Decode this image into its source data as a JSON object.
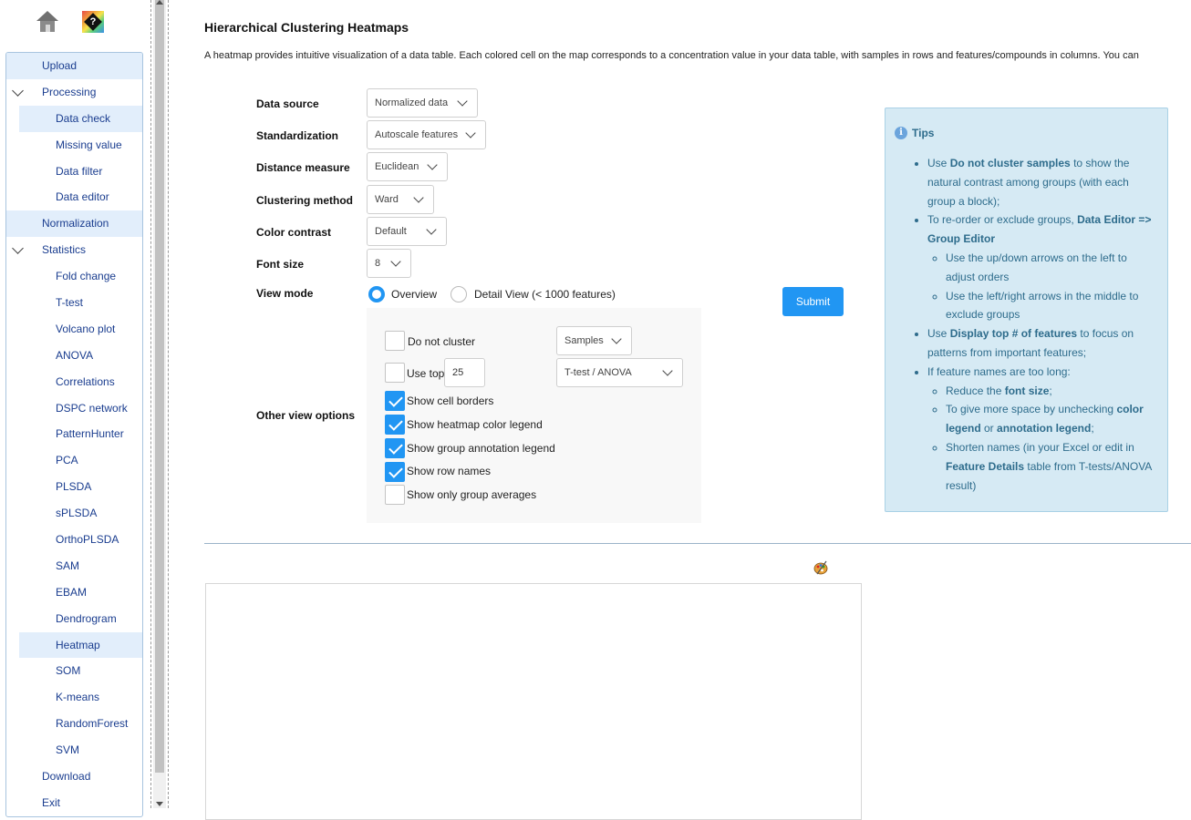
{
  "sidebar": {
    "menu": [
      {
        "label": "Upload",
        "level": 0,
        "highlight": true
      },
      {
        "label": "Processing",
        "level": 0,
        "expanded": true
      },
      {
        "label": "Data check",
        "level": 1,
        "highlight": true
      },
      {
        "label": "Missing value",
        "level": 1
      },
      {
        "label": "Data filter",
        "level": 1
      },
      {
        "label": "Data editor",
        "level": 1
      },
      {
        "label": "Normalization",
        "level": 0,
        "highlight": true
      },
      {
        "label": "Statistics",
        "level": 0,
        "expanded": true
      },
      {
        "label": "Fold change",
        "level": 1
      },
      {
        "label": "T-test",
        "level": 1
      },
      {
        "label": "Volcano plot",
        "level": 1
      },
      {
        "label": "ANOVA",
        "level": 1
      },
      {
        "label": "Correlations",
        "level": 1
      },
      {
        "label": "DSPC network",
        "level": 1
      },
      {
        "label": "PatternHunter",
        "level": 1
      },
      {
        "label": "PCA",
        "level": 1
      },
      {
        "label": "PLSDA",
        "level": 1
      },
      {
        "label": "sPLSDA",
        "level": 1
      },
      {
        "label": "OrthoPLSDA",
        "level": 1
      },
      {
        "label": "SAM",
        "level": 1
      },
      {
        "label": "EBAM",
        "level": 1
      },
      {
        "label": "Dendrogram",
        "level": 1
      },
      {
        "label": "Heatmap",
        "level": 1,
        "highlight": true
      },
      {
        "label": "SOM",
        "level": 1
      },
      {
        "label": "K-means",
        "level": 1
      },
      {
        "label": "RandomForest",
        "level": 1
      },
      {
        "label": "SVM",
        "level": 1
      },
      {
        "label": "Download",
        "level": 0
      },
      {
        "label": "Exit",
        "level": 0
      }
    ]
  },
  "main": {
    "title": "Hierarchical Clustering Heatmaps",
    "description": "A heatmap provides intuitive visualization of a data table. Each colored cell on the map corresponds to a concentration value in your data table, with samples in rows and features/compounds in columns. You can",
    "form": {
      "data_source": {
        "label": "Data source",
        "value": "Normalized data"
      },
      "standardization": {
        "label": "Standardization",
        "value": "Autoscale features"
      },
      "distance": {
        "label": "Distance measure",
        "value": "Euclidean"
      },
      "clustering": {
        "label": "Clustering method",
        "value": "Ward"
      },
      "color_contrast": {
        "label": "Color contrast",
        "value": "Default"
      },
      "font_size": {
        "label": "Font size",
        "value": "8"
      },
      "view_mode": {
        "label": "View mode",
        "overview": "Overview",
        "detail": "Detail View (< 1000 features)",
        "selected": "overview"
      },
      "other_options": {
        "label": "Other view options"
      },
      "submit": "Submit"
    },
    "options": {
      "do_not_cluster": {
        "label": "Do not cluster",
        "checked": false
      },
      "cluster_target": "Samples",
      "use_top": {
        "label": "Use top",
        "checked": false,
        "value": "25"
      },
      "top_method": "T-test / ANOVA",
      "cell_borders": {
        "label": "Show cell borders",
        "checked": true
      },
      "color_legend": {
        "label": "Show heatmap color legend",
        "checked": true
      },
      "annotation_legend": {
        "label": "Show group annotation legend",
        "checked": true
      },
      "row_names": {
        "label": "Show row names",
        "checked": true
      },
      "group_averages": {
        "label": "Show only group averages",
        "checked": false
      }
    },
    "tips": {
      "title": "Tips",
      "t1_pre": "Use ",
      "t1_bold": "Do not cluster samples",
      "t1_post": " to show the natural contrast among groups (with each group a block);",
      "t2_pre": "To re-order or exclude groups, ",
      "t2_bold": "Data Editor => Group Editor",
      "t2a": "Use the up/down arrows on the left to adjust orders",
      "t2b": "Use the left/right arrows in the middle to exclude groups",
      "t3_pre": "Use ",
      "t3_bold": "Display top # of features",
      "t3_post": " to focus on patterns from important features;",
      "t4": "If feature names are too long:",
      "t4a_pre": "Reduce the ",
      "t4a_bold": "font size",
      "t4a_post": ";",
      "t4b_pre": "To give more space by unchecking ",
      "t4b_bold1": "color legend",
      "t4b_mid": " or ",
      "t4b_bold2": "annotation legend",
      "t4b_post": ";",
      "t4c_pre": "Shorten names (in your Excel or edit in ",
      "t4c_bold": "Feature Details",
      "t4c_post": " table from T-tests/ANOVA result)"
    }
  },
  "colors": {
    "accent": "#2196f3",
    "menu_text": "#1a3d8f",
    "tips_bg": "#d6eaf4",
    "tips_text": "#2e6c8c"
  }
}
